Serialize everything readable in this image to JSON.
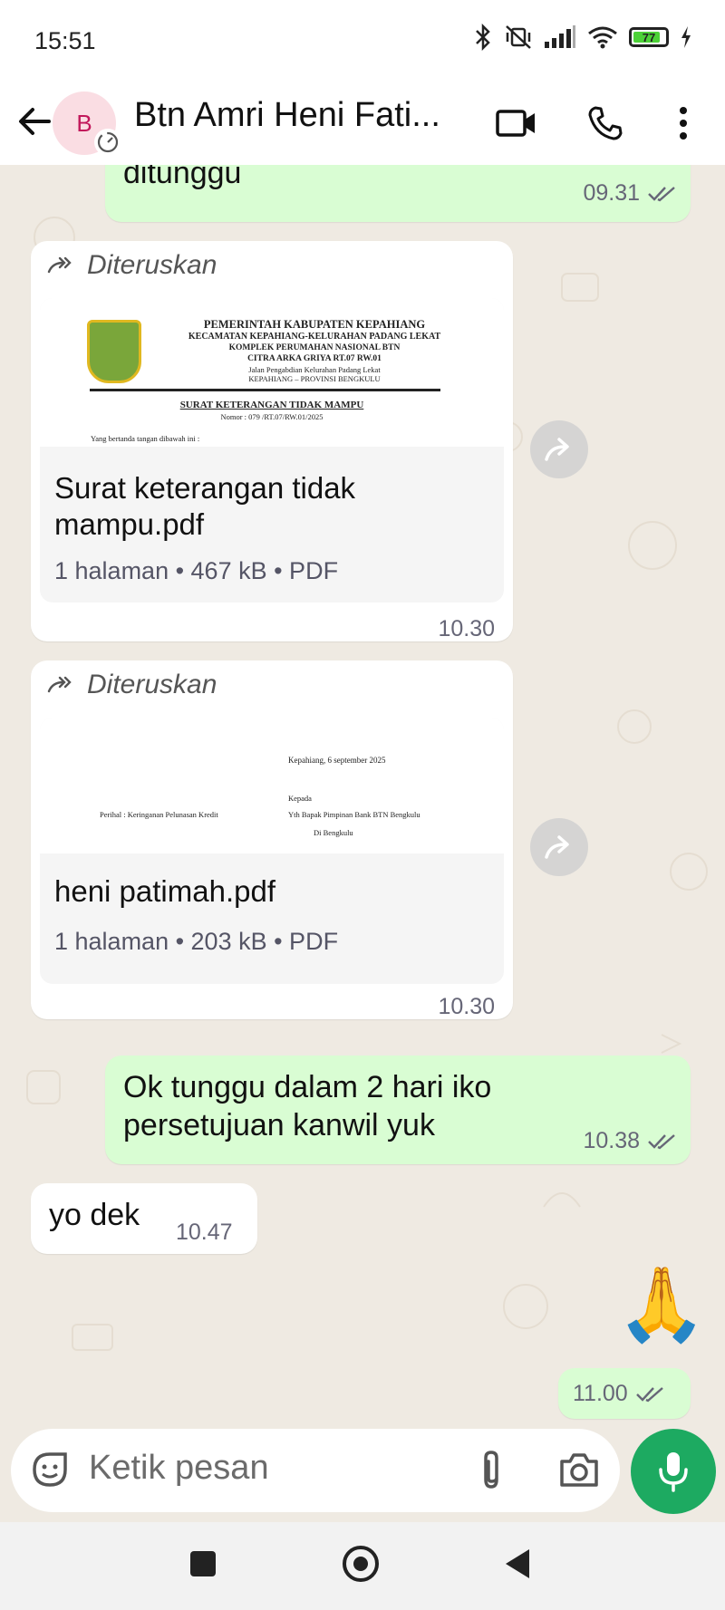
{
  "status_bar": {
    "time": "15:51",
    "battery": "77"
  },
  "header": {
    "avatar_letter": "B",
    "title": "Btn Amri Heni Fati..."
  },
  "messages": {
    "m1": {
      "text": "ditunggu",
      "time": "09.31"
    },
    "m2": {
      "forwarded_label": "Diteruskan",
      "doc_name": "Surat keterangan  tidak mampu.pdf",
      "doc_info": "1 halaman • 467 kB • PDF",
      "time": "10.30",
      "preview": {
        "line1": "PEMERINTAH KABUPATEN KEPAHIANG",
        "line2": "KECAMATAN KEPAHIANG-KELURAHAN PADANG LEKAT",
        "line3": "KOMPLEK PERUMAHAN NASIONAL BTN",
        "line4": "CITRA ARKA GRIYA RT.07 RW.01",
        "line5": "Jalan Pengabdian Kelurahan Padang Lekat",
        "line6": "KEPAHIANG – PROVINSI BENGKULU",
        "heading": "SURAT KETERANGAN TIDAK MAMPU",
        "nomor": "Nomor : 079 /RT.07/RW.01/2025",
        "body": "Yang bertanda tangan dibawah ini :"
      }
    },
    "m3": {
      "forwarded_label": "Diteruskan",
      "doc_name": "heni patimah.pdf",
      "doc_info": "1 halaman • 203 kB • PDF",
      "time": "10.30",
      "preview": {
        "date": "Kepahiang, 6 september 2025",
        "kepada": "Kepada",
        "perihal": "Perihal : Keringanan Pelunasan Kredit",
        "recipient": "Yth Bapak Pimpinan Bank BTN Bengkulu",
        "place": "Di Bengkulu"
      }
    },
    "m4": {
      "line1": "Ok tunggu dalam 2 hari iko",
      "line2": "persetujuan kanwil yuk",
      "time": "10.38"
    },
    "m5": {
      "text": "yo dek",
      "time": "10.47"
    },
    "m6": {
      "emoji": "🙏",
      "time": "11.00"
    }
  },
  "composer": {
    "placeholder": "Ketik pesan"
  },
  "colors": {
    "outgoing": "#d9fdd3",
    "incoming": "#ffffff",
    "accent": "#1daa61",
    "background": "#efeae2"
  }
}
